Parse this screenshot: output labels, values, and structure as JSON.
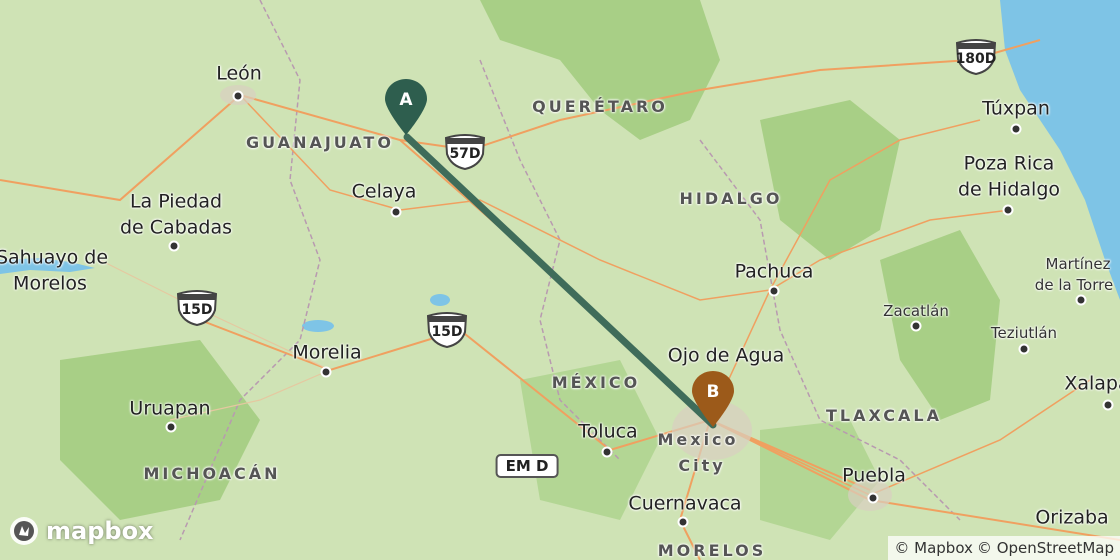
{
  "map": {
    "route": {
      "color": "#3f6c5a",
      "from": "A",
      "to": "B"
    },
    "markers": [
      {
        "label": "A",
        "color": "#2e5e4e"
      },
      {
        "label": "B",
        "color": "#9c5a1a"
      }
    ],
    "cities": [
      "León",
      "Celaya",
      "La Piedad",
      "de Cabadas",
      "Sahuayo de",
      "Morelos",
      "Morelia",
      "Uruapan",
      "Toluca",
      "Pachuca",
      "Ojo de Agua",
      "Cuernavaca",
      "Puebla",
      "Orizaba",
      "Túxpan",
      "Poza Rica",
      "de Hidalgo",
      "Martínez",
      "de la Torre",
      "Zacatlán",
      "Teziutlán",
      "Xalapa",
      "Mexico",
      "City"
    ],
    "regions": [
      "GUANAJUATO",
      "QUERÉTARO",
      "HIDALGO",
      "MÉXICO",
      "MICHOACÁN",
      "TLAXCALA",
      "MORELOS"
    ],
    "highways": [
      "180D",
      "57D",
      "15D",
      "15D",
      "EM D"
    ],
    "logo": "mapbox",
    "attribution": [
      "© Mapbox",
      "© OpenStreetMap"
    ]
  }
}
